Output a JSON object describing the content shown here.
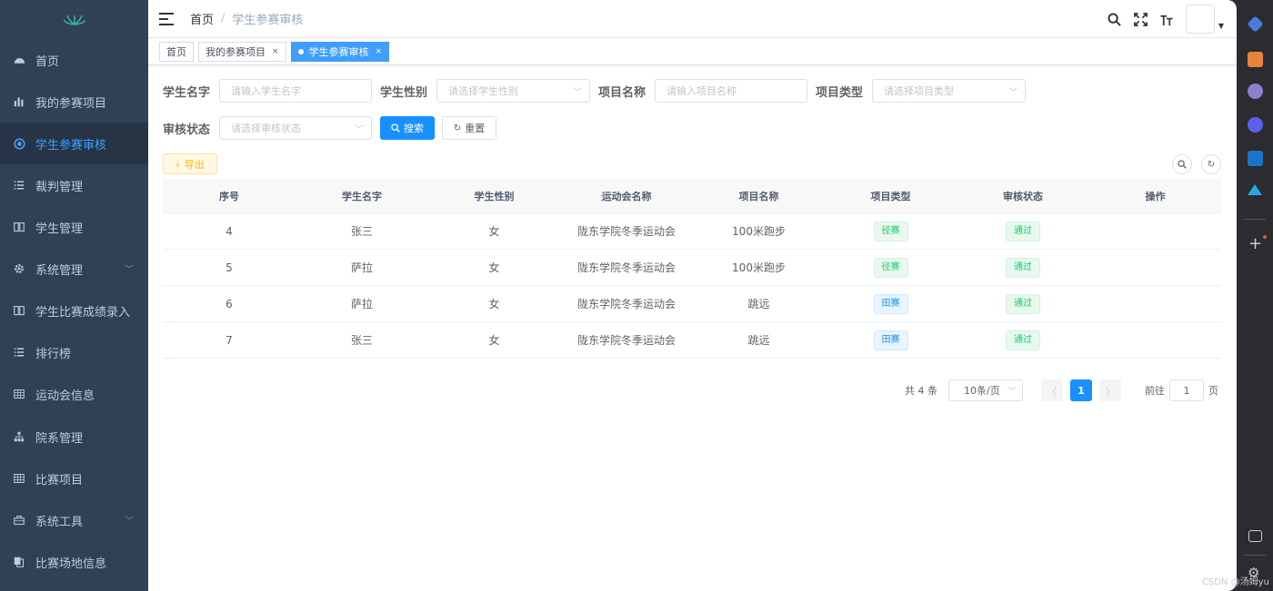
{
  "sidebar": {
    "items": [
      {
        "label": "首页",
        "icon": "dashboard-icon"
      },
      {
        "label": "我的参赛项目",
        "icon": "bar-chart-icon"
      },
      {
        "label": "学生参赛审核",
        "icon": "circle-icon",
        "active": true
      },
      {
        "label": "裁判管理",
        "icon": "list-icon"
      },
      {
        "label": "学生管理",
        "icon": "book-icon"
      },
      {
        "label": "系统管理",
        "icon": "gear-icon",
        "expandable": true
      },
      {
        "label": "学生比赛成绩录入",
        "icon": "book-icon"
      },
      {
        "label": "排行榜",
        "icon": "list-icon"
      },
      {
        "label": "运动会信息",
        "icon": "table-icon"
      },
      {
        "label": "院系管理",
        "icon": "tree-icon"
      },
      {
        "label": "比赛项目",
        "icon": "table-icon"
      },
      {
        "label": "系统工具",
        "icon": "toolbox-icon",
        "expandable": true
      },
      {
        "label": "比赛场地信息",
        "icon": "copy-icon"
      }
    ]
  },
  "header": {
    "breadcrumb_home": "首页",
    "breadcrumb_sep": "/",
    "breadcrumb_current": "学生参赛审核"
  },
  "tags": [
    {
      "label": "首页",
      "closable": false,
      "active": false
    },
    {
      "label": "我的参赛项目",
      "closable": true,
      "active": false
    },
    {
      "label": "学生参赛审核",
      "closable": true,
      "active": true
    }
  ],
  "search": {
    "student_name_label": "学生名字",
    "student_name_placeholder": "请输入学生名字",
    "gender_label": "学生性别",
    "gender_placeholder": "请选择学生性别",
    "project_name_label": "项目名称",
    "project_name_placeholder": "请输入项目名称",
    "project_type_label": "项目类型",
    "project_type_placeholder": "请选择项目类型",
    "audit_status_label": "审核状态",
    "audit_status_placeholder": "请选择审核状态",
    "search_button": "搜索",
    "reset_button": "重置"
  },
  "toolbar": {
    "export_button": "导出"
  },
  "table": {
    "columns": [
      "序号",
      "学生名字",
      "学生性别",
      "运动会名称",
      "项目名称",
      "项目类型",
      "审核状态",
      "操作"
    ],
    "rows": [
      {
        "id": "4",
        "name": "张三",
        "gender": "女",
        "meet": "陇东学院冬季运动会",
        "project": "100米跑步",
        "type": "径赛",
        "type_color": "green",
        "status": "通过"
      },
      {
        "id": "5",
        "name": "萨拉",
        "gender": "女",
        "meet": "陇东学院冬季运动会",
        "project": "100米跑步",
        "type": "径赛",
        "type_color": "green",
        "status": "通过"
      },
      {
        "id": "6",
        "name": "萨拉",
        "gender": "女",
        "meet": "陇东学院冬季运动会",
        "project": "跳远",
        "type": "田赛",
        "type_color": "blue",
        "status": "通过"
      },
      {
        "id": "7",
        "name": "张三",
        "gender": "女",
        "meet": "陇东学院冬季运动会",
        "project": "跳远",
        "type": "田赛",
        "type_color": "blue",
        "status": "通过"
      }
    ]
  },
  "pagination": {
    "total_text": "共 4 条",
    "page_size": "10条/页",
    "current_page": "1",
    "jump_prefix": "前往",
    "jump_value": "1",
    "jump_suffix": "页"
  },
  "watermark": "CSDN @汤姆yu",
  "colors": {
    "sidebar_bg": "#304156",
    "primary": "#1890ff",
    "success": "#13ce66",
    "warning": "#ffba00"
  }
}
